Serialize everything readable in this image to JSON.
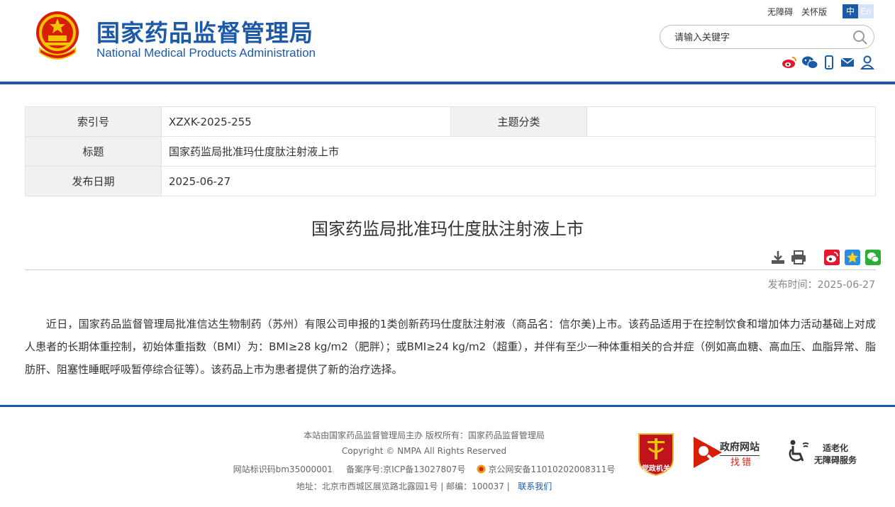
{
  "header": {
    "site_name_cn": "国家药品监督管理局",
    "site_name_en": "National Medical Products Administration",
    "accessibility_link": "无障碍",
    "care_mode_link": "关怀版",
    "lang_cn": "中",
    "lang_en": "En",
    "search_placeholder": "请输入关键字",
    "social_icons": [
      "weibo-icon",
      "wechat-icon",
      "mobile-icon",
      "mail-icon",
      "user-icon"
    ],
    "brand_color": "#1c5aa8"
  },
  "info": {
    "index_label": "索引号",
    "index_value": "XZXK-2025-255",
    "category_label": "主题分类",
    "category_value": "",
    "title_label": "标题",
    "title_value": "国家药监局批准玛仕度肽注射液上市",
    "date_label": "发布日期",
    "date_value": "2025-06-27"
  },
  "article": {
    "title": "国家药监局批准玛仕度肽注射液上市",
    "pub_date": "发布时间：2025-06-27",
    "body": "近日，国家药品监督管理局批准信达生物制药（苏州）有限公司申报的1类创新药玛仕度肽注射液（商品名：信尔美)上市。该药品适用于在控制饮食和增加体力活动基础上对成人患者的长期体重控制，初始体重指数（BMI）为：BMI≥28 kg/m2（肥胖）；或BMI≥24 kg/m2（超重），并伴有至少一种体重相关的合并症（例如高血糖、高血压、血脂异常、脂肪肝、阻塞性睡眠呼吸暂停综合征等）。该药品上市为患者提供了新的治疗选择。",
    "tools": [
      "download-icon",
      "print-icon",
      "share-weibo-icon",
      "share-qzone-icon",
      "share-wechat-icon"
    ]
  },
  "footer": {
    "line1": "本站由国家药品监督管理局主办 版权所有：国家药品监督管理局",
    "line2": "Copyright © NMPA All Rights Reserved",
    "site_id": "网站标识码bm35000001",
    "icp": "备案序号:京ICP备13027807号",
    "police": "京公网安备11010202008311号",
    "address": "地址：北京市西城区展览路北露园1号 | 邮编：100037 |",
    "contact": "联系我们",
    "badge_party": "党政机关",
    "badge_gov_top": "政府网站",
    "badge_gov_bottom": "找错",
    "badge_access_top": "适老化",
    "badge_access_bottom": "无障碍服务"
  }
}
